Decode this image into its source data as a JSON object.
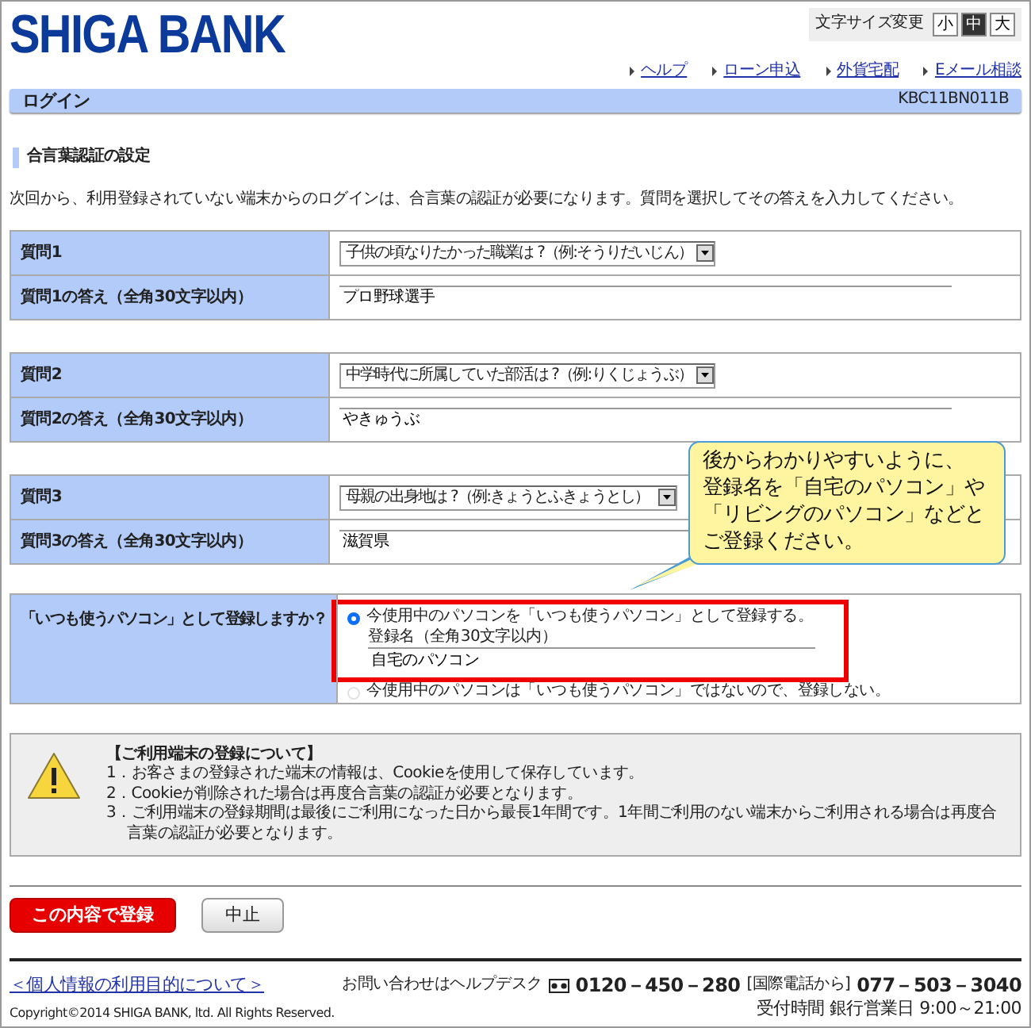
{
  "header": {
    "logo": "SHIGA BANK",
    "font_size": {
      "label": "文字サイズ変更",
      "options": [
        {
          "label": "小",
          "selected": false
        },
        {
          "label": "中",
          "selected": true
        },
        {
          "label": "大",
          "selected": false
        }
      ]
    },
    "links": [
      "ヘルプ",
      "ローン申込",
      "外貨宅配",
      "Eメール相談"
    ]
  },
  "title_bar": {
    "title": "ログイン",
    "screen_id": "KBC11BN011B"
  },
  "section_heading": "合言葉認証の設定",
  "intro": "次回から、利用登録されていない端末からのログインは、合言葉の認証が必要になります。質問を選択してその答えを入力してください。",
  "questions": [
    {
      "question_label": "質問1",
      "question": "子供の頃なりたかった職業は ?（例:そうりだいじん）",
      "answer_label": "質問1の答え（全角30文字以内）",
      "answer": "プロ野球選手"
    },
    {
      "question_label": "質問2",
      "question": "中学時代に所属していた部活は ?（例:りくじょうぶ）",
      "answer_label": "質問2の答え（全角30文字以内）",
      "answer": "やきゅうぶ"
    },
    {
      "question_label": "質問3",
      "question": "母親の出身地は ?（例:きょうとふきょうとし）",
      "answer_label": "質問3の答え（全角30文字以内）",
      "answer": "滋賀県"
    }
  ],
  "registration": {
    "label": "「いつも使うパソコン」として登録しますか？",
    "options": [
      {
        "label": "今使用中のパソコンを「いつも使うパソコン」として登録する。",
        "selected": true
      },
      {
        "label": "今使用中のパソコンは「いつも使うパソコン」ではないので、登録しない。",
        "selected": false
      }
    ],
    "name_label": "登録名（全角30文字以内）",
    "name_value": "自宅のパソコン"
  },
  "callout": {
    "lines": [
      "後からわかりやすいように、",
      "登録名を「自宅のパソコン」や",
      "「リビングのパソコン」などと",
      "ご登録ください。"
    ]
  },
  "notice": {
    "title": "【ご利用端末の登録について】",
    "items": [
      "1．お客さまの登録された端末の情報は、Cookieを使用して保存しています。",
      "2．Cookieが削除された場合は再度合言葉の認証が必要となります。",
      "3．ご利用端末の登録期間は最後にご利用になった日から最長1年間です。1年間ご利用のない端末からご利用される場合は再度合言葉の認証が必要となります。"
    ]
  },
  "buttons": [
    {
      "label": "この内容で登録",
      "kind": "primary"
    },
    {
      "label": "中止",
      "kind": "secondary"
    }
  ],
  "footer": {
    "privacy_link": "＜個人情報の利用目的について＞",
    "contact": "お問い合わせはヘルプデスク",
    "phone": "0120－450－280",
    "intl_label": "[国際電話から]",
    "intl_phone": "077－503－3040",
    "hours": "受付時間 銀行営業日 9:00～21:00",
    "copyright": "Copyright©2014 SHIGA BANK, ltd. All Rights Reserved."
  }
}
